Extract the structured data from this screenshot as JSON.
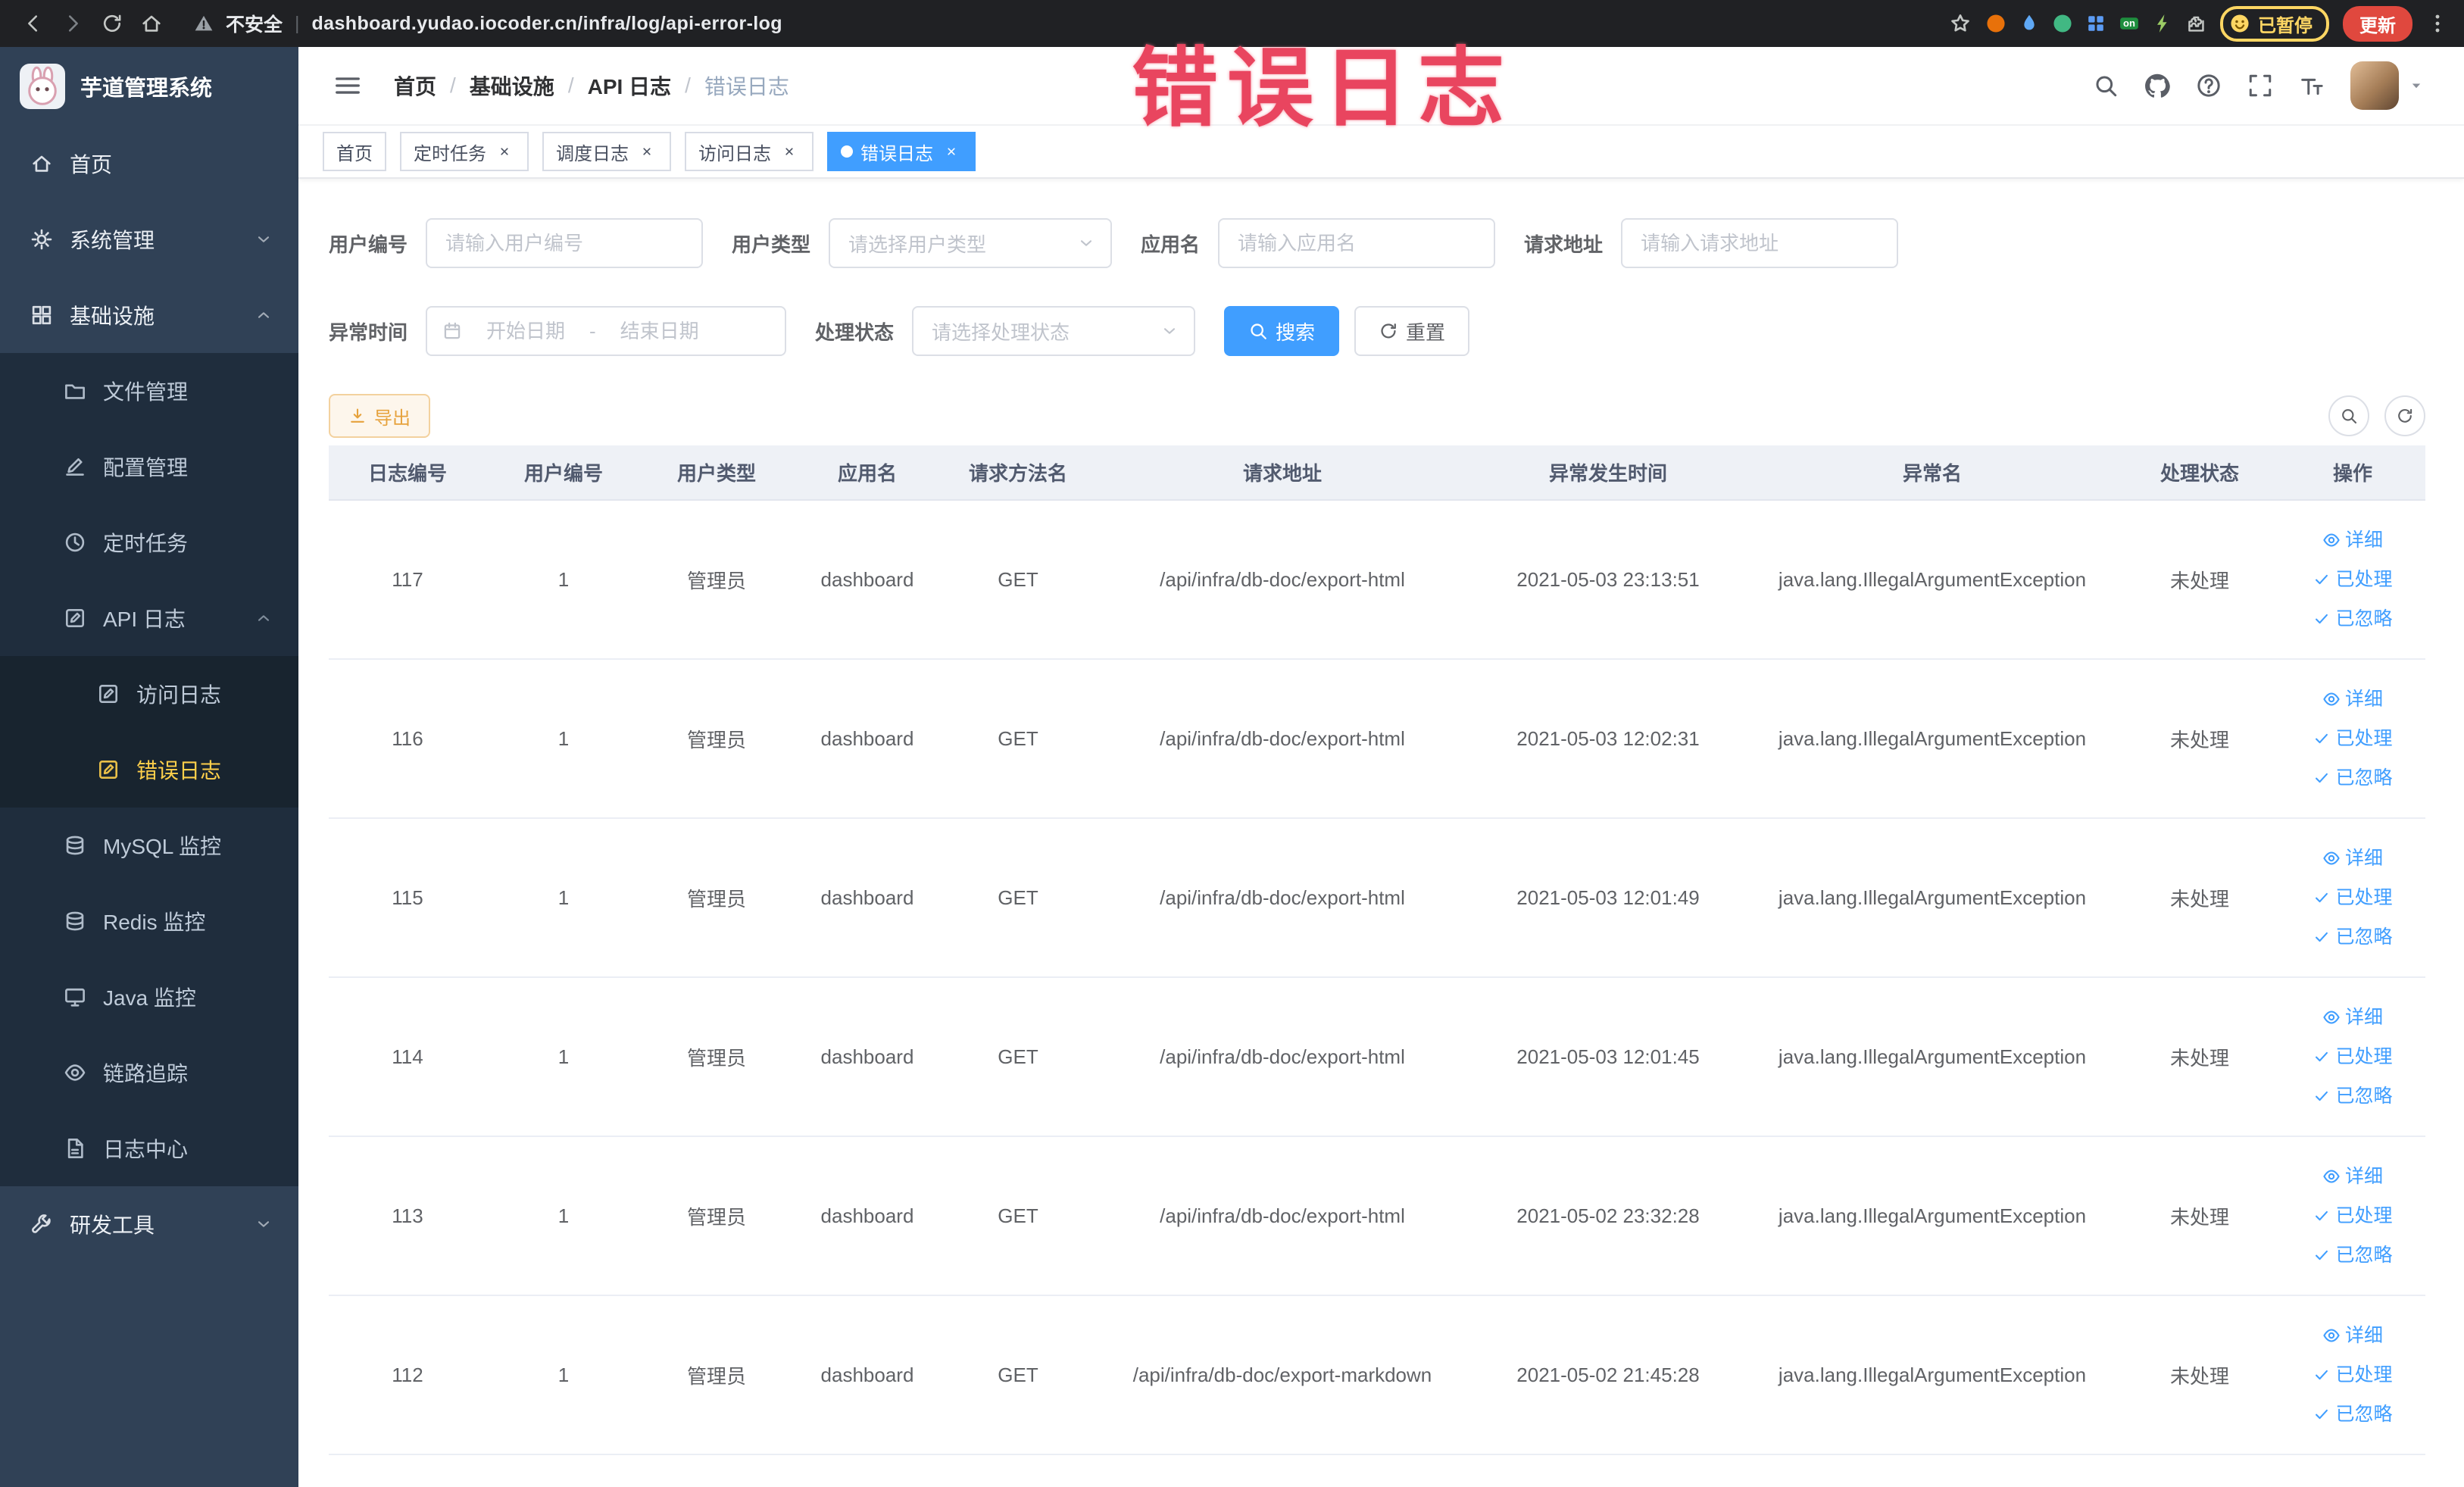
{
  "watermark_text": "错误日志",
  "browser": {
    "security_label": "不安全",
    "address_separator": "|",
    "url": "dashboard.yudao.iocoder.cn/infra/log/api-error-log",
    "paused_badge": "已暂停",
    "update_label": "更新",
    "extensions": [
      {
        "name": "extension-orange-circle",
        "icon": "circle-fill",
        "color": "#e8710a"
      },
      {
        "name": "extension-blue-drop",
        "icon": "drop",
        "color": "#5fa8f5"
      },
      {
        "name": "extension-green-circle",
        "icon": "circle-fill",
        "color": "#41b883"
      },
      {
        "name": "extension-blue-grid",
        "icon": "squares",
        "color": "#5c9cf5"
      },
      {
        "name": "extension-on-badge",
        "icon": "on-badge",
        "color": "#1e8e3e",
        "label": "on"
      },
      {
        "name": "extension-bolt",
        "icon": "bolt",
        "color": "#9ccc65"
      },
      {
        "name": "extension-puzzle",
        "icon": "puzzle",
        "color": "#c4c7c5"
      }
    ]
  },
  "sidebar": {
    "logo_title": "芋道管理系统",
    "items": [
      {
        "name": "home",
        "label": "首页",
        "icon": "home",
        "depth": 0
      },
      {
        "name": "system-management",
        "label": "系统管理",
        "icon": "gear",
        "depth": 0,
        "chevron": "down"
      },
      {
        "name": "infrastructure",
        "label": "基础设施",
        "icon": "grid",
        "depth": 0,
        "chevron": "up"
      },
      {
        "name": "file-management",
        "label": "文件管理",
        "icon": "folder",
        "depth": 1
      },
      {
        "name": "config-management",
        "label": "配置管理",
        "icon": "edit",
        "depth": 1
      },
      {
        "name": "scheduled-tasks",
        "label": "定时任务",
        "icon": "clock",
        "depth": 1
      },
      {
        "name": "api-logs",
        "label": "API 日志",
        "icon": "edit-square",
        "depth": 1,
        "chevron": "up"
      },
      {
        "name": "access-logs",
        "label": "访问日志",
        "icon": "edit-square",
        "depth": 2
      },
      {
        "name": "error-logs",
        "label": "错误日志",
        "icon": "edit-square",
        "depth": 2,
        "active": true
      },
      {
        "name": "mysql-monitor",
        "label": "MySQL 监控",
        "icon": "db",
        "depth": 1
      },
      {
        "name": "redis-monitor",
        "label": "Redis 监控",
        "icon": "db",
        "depth": 1
      },
      {
        "name": "java-monitor",
        "label": "Java 监控",
        "icon": "monitor",
        "depth": 1
      },
      {
        "name": "trace",
        "label": "链路追踪",
        "icon": "eye",
        "depth": 1
      },
      {
        "name": "log-center",
        "label": "日志中心",
        "icon": "doc",
        "depth": 1
      },
      {
        "name": "dev-tools",
        "label": "研发工具",
        "icon": "wrench",
        "depth": 0,
        "chevron": "down"
      }
    ]
  },
  "navbar": {
    "breadcrumb_separator": "/",
    "breadcrumb": [
      {
        "label": "首页"
      },
      {
        "label": "基础设施"
      },
      {
        "label": "API 日志"
      },
      {
        "label": "错误日志",
        "current": true
      }
    ]
  },
  "tags": [
    {
      "name": "home",
      "label": "首页",
      "closable": false
    },
    {
      "name": "scheduled-tasks",
      "label": "定时任务",
      "closable": true
    },
    {
      "name": "schedule-logs",
      "label": "调度日志",
      "closable": true
    },
    {
      "name": "access-logs",
      "label": "访问日志",
      "closable": true
    },
    {
      "name": "error-logs",
      "label": "错误日志",
      "closable": true,
      "active": true
    }
  ],
  "filters": {
    "user_id": {
      "label": "用户编号",
      "placeholder": "请输入用户编号"
    },
    "user_type": {
      "label": "用户类型",
      "placeholder": "请选择用户类型"
    },
    "app_name": {
      "label": "应用名",
      "placeholder": "请输入应用名"
    },
    "request_url": {
      "label": "请求地址",
      "placeholder": "请输入请求地址"
    },
    "exception_time": {
      "label": "异常时间",
      "start_placeholder": "开始日期",
      "separator": "-",
      "end_placeholder": "结束日期"
    },
    "process_status": {
      "label": "处理状态",
      "placeholder": "请选择处理状态"
    },
    "search_label": "搜索",
    "reset_label": "重置"
  },
  "toolbar": {
    "export_label": "导出"
  },
  "table": {
    "columns": [
      "日志编号",
      "用户编号",
      "用户类型",
      "应用名",
      "请求方法名",
      "请求地址",
      "异常发生时间",
      "异常名",
      "处理状态",
      "操作"
    ],
    "action_labels": [
      "详细",
      "已处理",
      "已忽略"
    ],
    "rows": [
      {
        "id": "117",
        "user_id": "1",
        "user_type": "管理员",
        "app": "dashboard",
        "method": "GET",
        "url": "/api/infra/db-doc/export-html",
        "time": "2021-05-03 23:13:51",
        "exception": "java.lang.IllegalArgumentException",
        "status": "未处理"
      },
      {
        "id": "116",
        "user_id": "1",
        "user_type": "管理员",
        "app": "dashboard",
        "method": "GET",
        "url": "/api/infra/db-doc/export-html",
        "time": "2021-05-03 12:02:31",
        "exception": "java.lang.IllegalArgumentException",
        "status": "未处理"
      },
      {
        "id": "115",
        "user_id": "1",
        "user_type": "管理员",
        "app": "dashboard",
        "method": "GET",
        "url": "/api/infra/db-doc/export-html",
        "time": "2021-05-03 12:01:49",
        "exception": "java.lang.IllegalArgumentException",
        "status": "未处理"
      },
      {
        "id": "114",
        "user_id": "1",
        "user_type": "管理员",
        "app": "dashboard",
        "method": "GET",
        "url": "/api/infra/db-doc/export-html",
        "time": "2021-05-03 12:01:45",
        "exception": "java.lang.IllegalArgumentException",
        "status": "未处理"
      },
      {
        "id": "113",
        "user_id": "1",
        "user_type": "管理员",
        "app": "dashboard",
        "method": "GET",
        "url": "/api/infra/db-doc/export-html",
        "time": "2021-05-02 23:32:28",
        "exception": "java.lang.IllegalArgumentException",
        "status": "未处理"
      },
      {
        "id": "112",
        "user_id": "1",
        "user_type": "管理员",
        "app": "dashboard",
        "method": "GET",
        "url": "/api/infra/db-doc/export-markdown",
        "time": "2021-05-02 21:45:28",
        "exception": "java.lang.IllegalArgumentException",
        "status": "未处理"
      }
    ]
  }
}
